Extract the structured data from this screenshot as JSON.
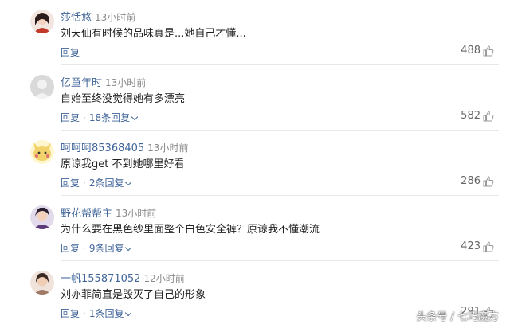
{
  "comments": [
    {
      "user": "莎恬悠",
      "time": "13小时前",
      "text": "刘天仙有时候的品味真是...她自己才懂...",
      "reply_label": "回复",
      "replies_label": "",
      "likes": "488",
      "avatar_color": "#c0392b"
    },
    {
      "user": "亿童年时",
      "time": "13小时前",
      "text": "自始至终没觉得她有多漂亮",
      "reply_label": "回复",
      "replies_label": "18条回复",
      "likes": "582",
      "avatar_color": "#cfcfcf"
    },
    {
      "user": "呵呵呵85368405",
      "time": "13小时前",
      "text": "原谅我get 不到她哪里好看",
      "reply_label": "回复",
      "replies_label": "2条回复",
      "likes": "286",
      "avatar_color": "#f2d36b"
    },
    {
      "user": "野花帮帮主",
      "time": "13小时前",
      "text": "为什么要在黑色纱里面整个白色安全裤？原谅我不懂潮流",
      "reply_label": "回复",
      "replies_label": "9条回复",
      "likes": "423",
      "avatar_color": "#5b3a7a"
    },
    {
      "user": "一帆155871052",
      "time": "12小时前",
      "text": "刘亦菲简直是毁灭了自己的形象",
      "reply_label": "回复",
      "replies_label": "1条回复",
      "likes": "291",
      "avatar_color": "#a07a66"
    }
  ],
  "watermark": "头条号 / 七巧魔方",
  "icons": {
    "like": "thumbs-up-icon",
    "expand": "chevron-down-icon"
  }
}
